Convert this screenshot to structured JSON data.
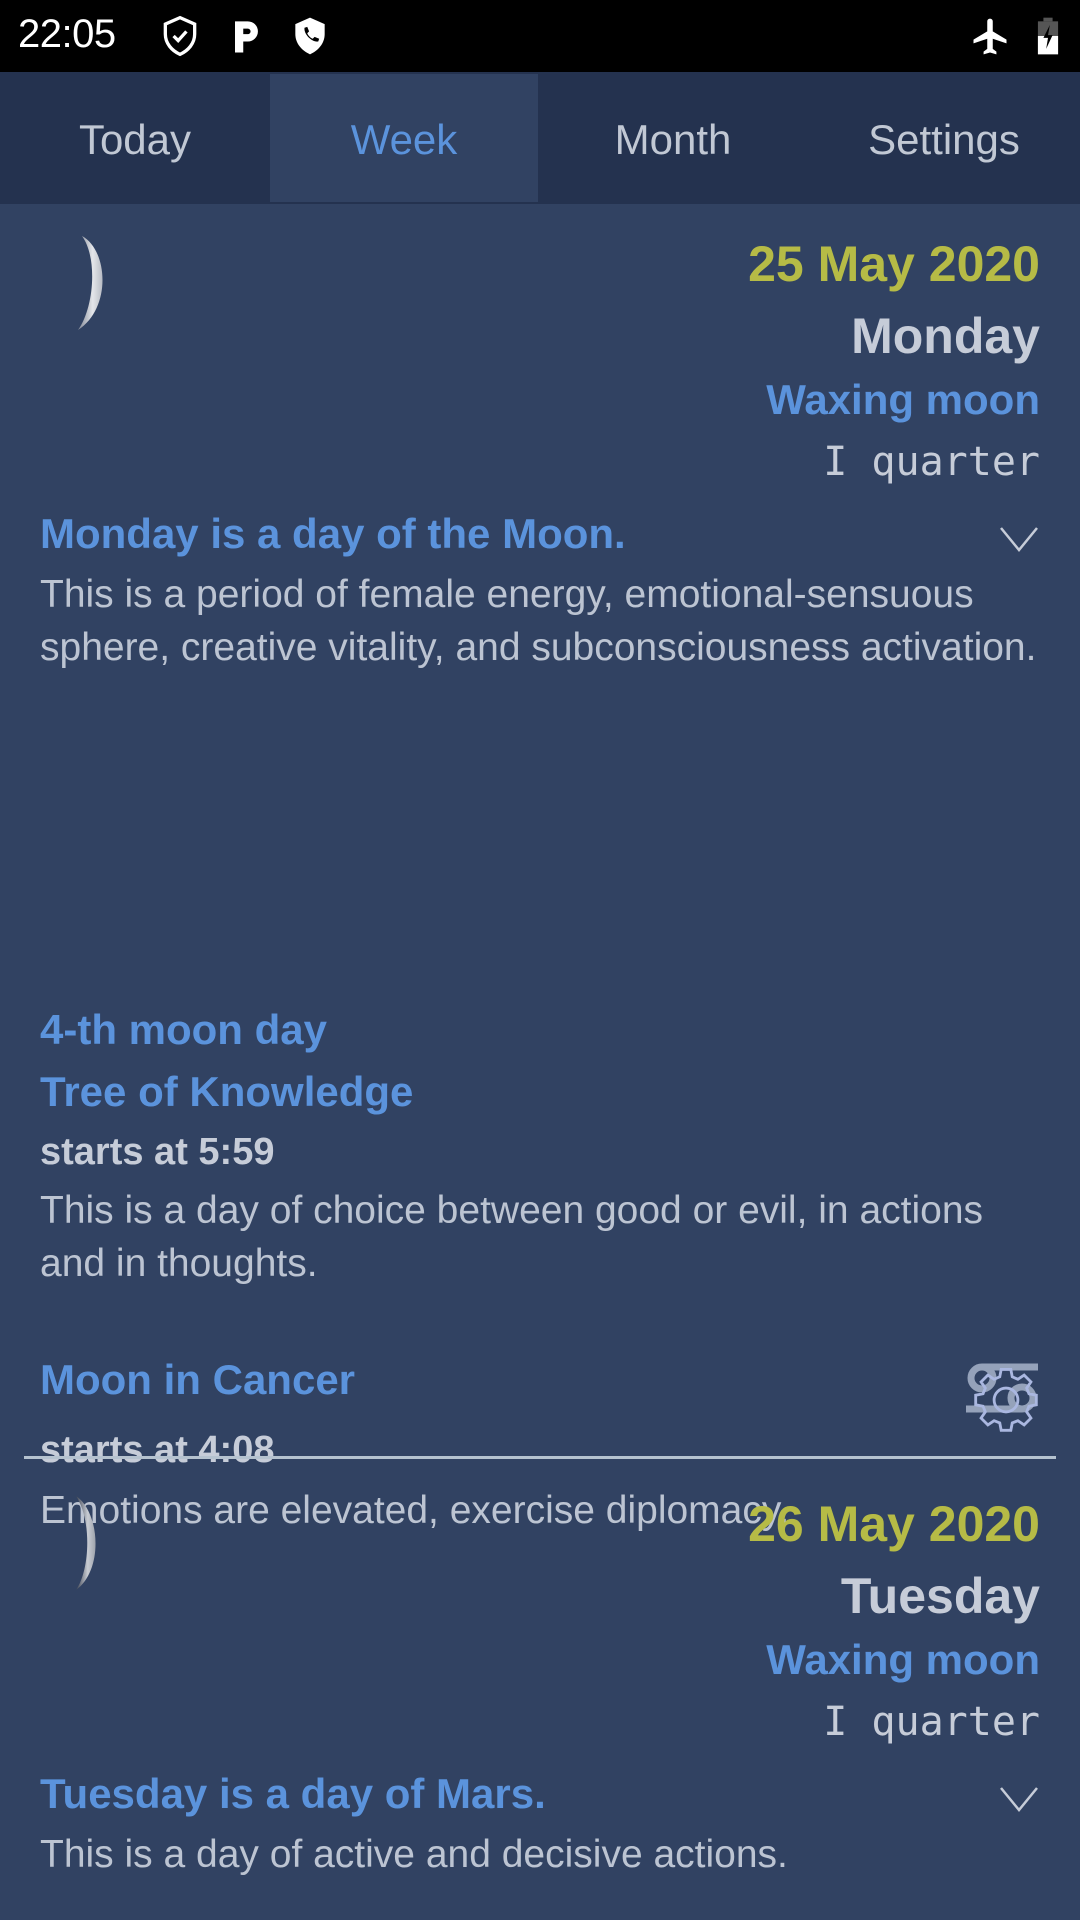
{
  "status_bar": {
    "time": "22:05",
    "left_icons": [
      "shield-check-icon",
      "parking-icon",
      "shield-phone-icon"
    ],
    "right_icons": [
      "airplane-mode-icon",
      "battery-charging-icon"
    ]
  },
  "tabs": [
    {
      "label": "Today",
      "active": false
    },
    {
      "label": "Week",
      "active": true
    },
    {
      "label": "Month",
      "active": false
    },
    {
      "label": "Settings",
      "active": false
    }
  ],
  "colors": {
    "background": "#314262",
    "tab_bar": "#24324f",
    "accent_blue": "#5b93dc",
    "date_yellow": "#b6bb46",
    "text_light": "#c6ccd8"
  },
  "days": [
    {
      "date": "25 May 2020",
      "weekday": "Monday",
      "phase": "Waxing moon",
      "quarter": "I quarter",
      "planet_title": "Monday is a day of the Moon.",
      "planet_text": "This is a period of female energy, emotional-sensuous sphere, creative vitality, and subconsciousness activation.",
      "moon_day_title": "4-th moon day",
      "moon_day_name": "Tree of Knowledge",
      "moon_day_start": "starts at 5:59",
      "moon_day_text": "This is a day of choice between good or evil, in actions and in thoughts.",
      "sign_title": "Moon in Cancer",
      "sign_icon": "cancer-zodiac-icon",
      "sign_start": "starts at 4:08",
      "sign_text": "Emotions are elevated, exercise diplomacy."
    },
    {
      "date": "26 May 2020",
      "weekday": "Tuesday",
      "phase": "Waxing moon",
      "quarter": "I quarter",
      "planet_title": "Tuesday is a day of Mars.",
      "planet_text": "This is a day of active and decisive actions."
    }
  ]
}
